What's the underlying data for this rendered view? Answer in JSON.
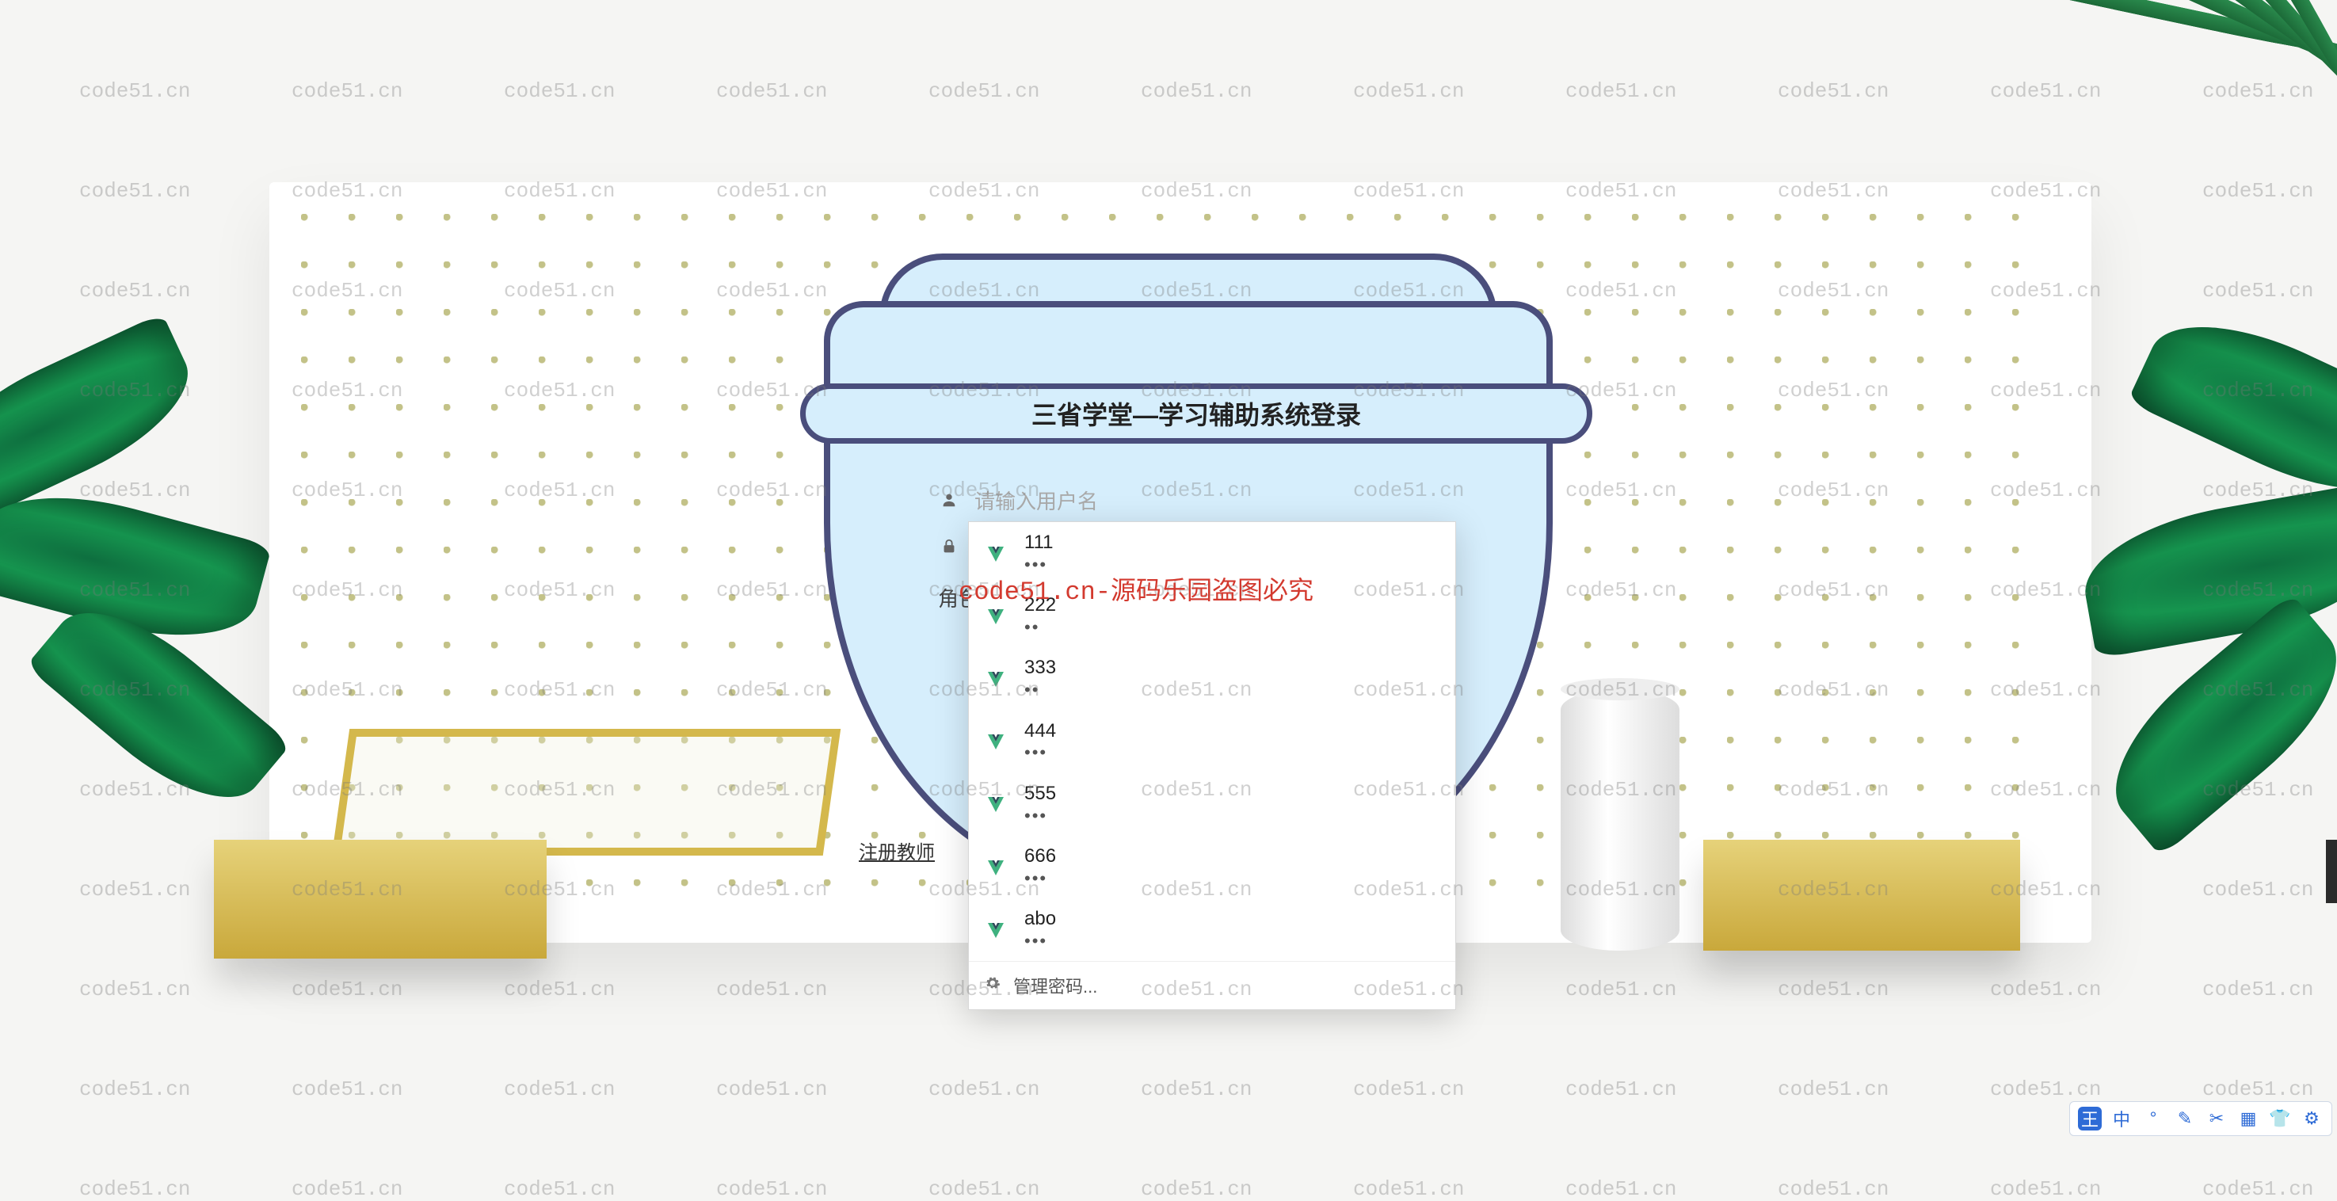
{
  "watermark_text": "code51.cn",
  "watermark_red": "code51.cn-源码乐园盗图必究",
  "title": "三省学堂—学习辅助系统登录",
  "form": {
    "username_placeholder": "请输入用户名",
    "username_value": "",
    "role_label": "角色",
    "register_link": "注册教师"
  },
  "autocomplete": {
    "items": [
      {
        "name": "111",
        "mask": "•••"
      },
      {
        "name": "222",
        "mask": "••"
      },
      {
        "name": "333",
        "mask": "••"
      },
      {
        "name": "444",
        "mask": "•••"
      },
      {
        "name": "555",
        "mask": "•••"
      },
      {
        "name": "666",
        "mask": "•••"
      },
      {
        "name": "abo",
        "mask": "•••"
      }
    ],
    "footer": "管理密码..."
  },
  "ime": {
    "logo": "王",
    "items": [
      "中",
      "°",
      "✎",
      "✂",
      "▦",
      "👕",
      "⚙"
    ]
  }
}
